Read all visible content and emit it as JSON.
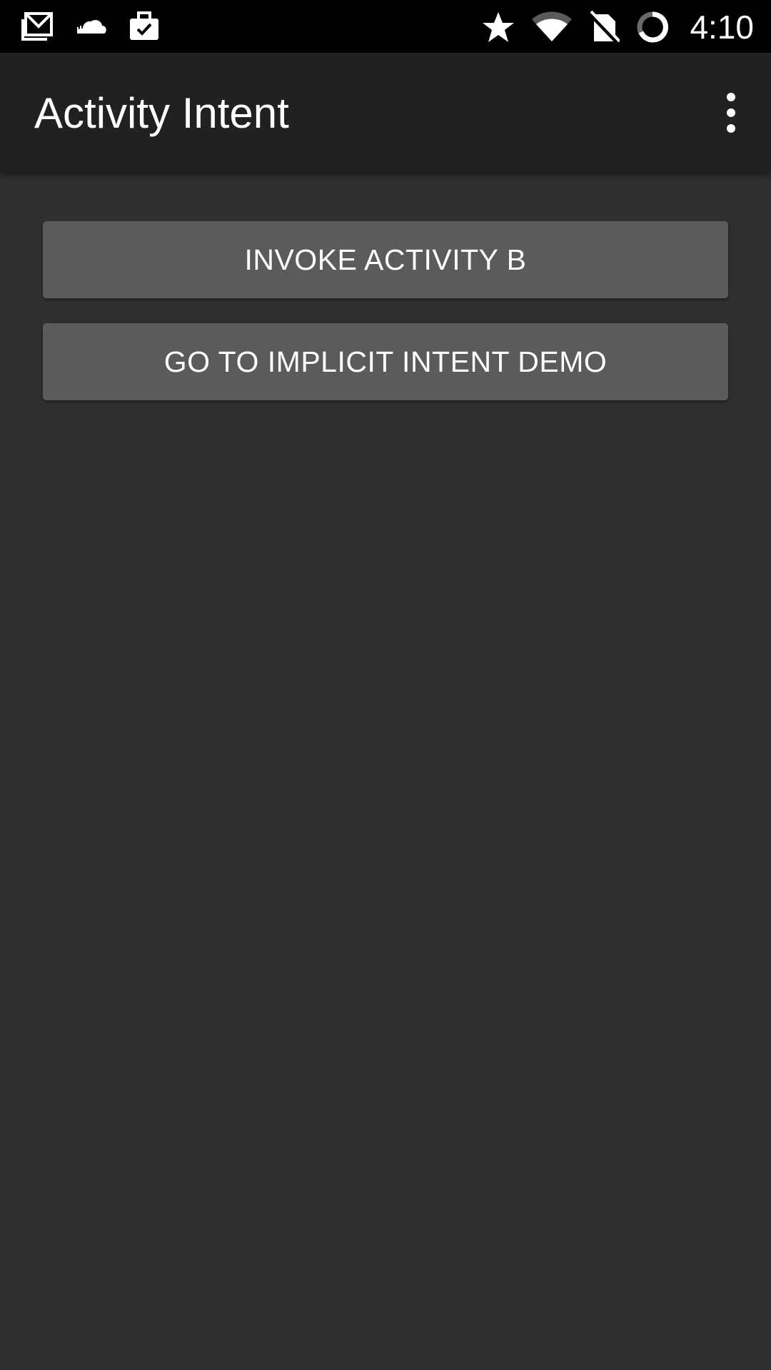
{
  "status_bar": {
    "time": "4:10",
    "left_icons": [
      "gmail-icon",
      "cloud-icon",
      "briefcase-check-icon"
    ],
    "right_icons": [
      "star-icon",
      "wifi-icon",
      "no-sim-icon",
      "sync-circle-icon"
    ]
  },
  "app_bar": {
    "title": "Activity Intent",
    "menu_icon": "more-vert-icon"
  },
  "main": {
    "buttons": [
      {
        "label": "INVOKE ACTIVITY B"
      },
      {
        "label": "GO TO IMPLICIT INTENT DEMO"
      }
    ]
  },
  "colors": {
    "status_bar": "#000000",
    "app_bar": "#212121",
    "background": "#303030",
    "button": "#5b5b5c",
    "text": "#ffffff"
  }
}
